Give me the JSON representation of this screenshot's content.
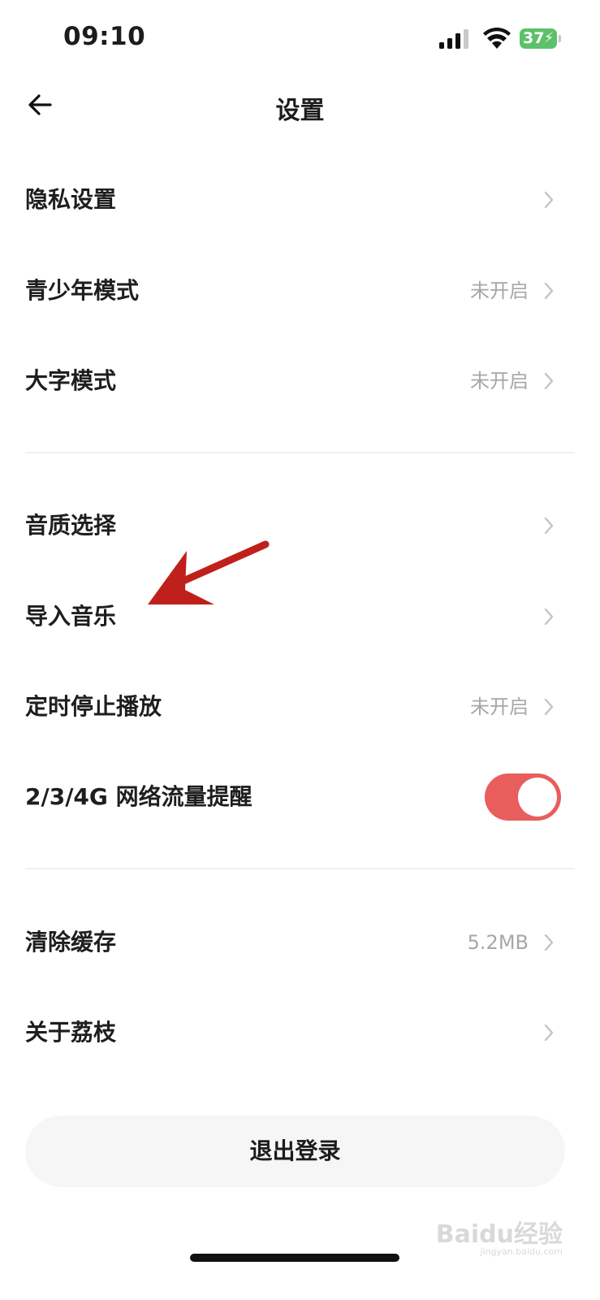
{
  "status_bar": {
    "time": "09:10",
    "battery_level": "37",
    "battery_color": "#5cc16a",
    "icons": [
      "signal-icon",
      "wifi-icon",
      "battery-icon"
    ]
  },
  "nav": {
    "title": "设置",
    "back_icon": "arrow-left-icon"
  },
  "settings": {
    "privacy": {
      "label": "隐私设置"
    },
    "teen_mode": {
      "label": "青少年模式",
      "value": "未开启"
    },
    "large_font": {
      "label": "大字模式",
      "value": "未开启"
    },
    "audio_quality": {
      "label": "音质选择"
    },
    "import_music": {
      "label": "导入音乐"
    },
    "sleep_timer": {
      "label": "定时停止播放",
      "value": "未开启"
    },
    "data_alert": {
      "label": "2/3/4G 网络流量提醒",
      "enabled": true
    },
    "clear_cache": {
      "label": "清除缓存",
      "value": "5.2MB"
    },
    "about": {
      "label": "关于荔枝"
    }
  },
  "logout": {
    "label": "退出登录"
  },
  "colors": {
    "accent_toggle": "#e85e5c",
    "annotation_arrow": "#c0201c",
    "secondary_text": "#a7a7a7"
  },
  "watermark": {
    "text": "Baidu经验",
    "sub": "jingyan.baidu.com"
  }
}
